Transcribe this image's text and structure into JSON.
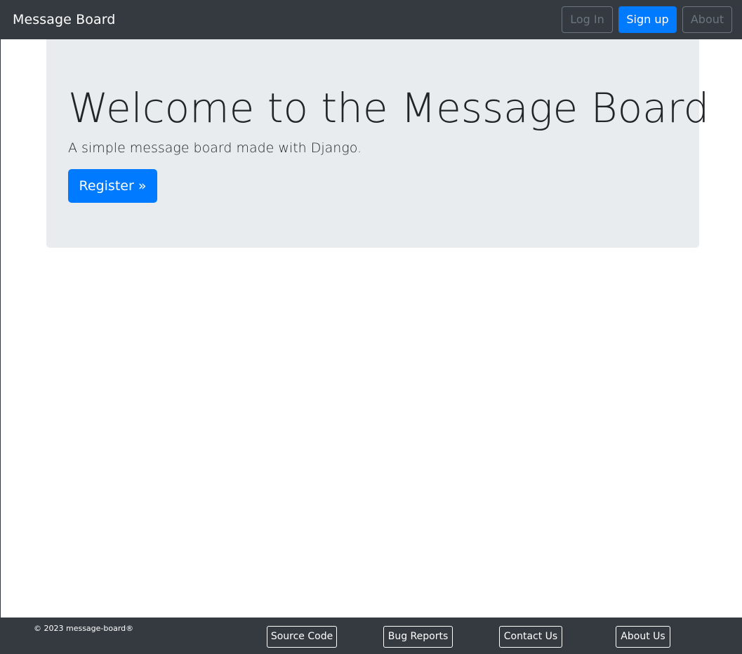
{
  "navbar": {
    "brand": "Message Board",
    "login_label": "Log In",
    "signup_label": "Sign up",
    "about_label": "About"
  },
  "jumbotron": {
    "title": "Welcome to the Message Board",
    "lead": "A simple message board made with Django.",
    "register_label": "Register »"
  },
  "footer": {
    "copyright": "© 2023 message-board®",
    "links": {
      "source_code": "Source Code",
      "bug_reports": "Bug Reports",
      "contact_us": "Contact Us",
      "about_us": "About Us"
    }
  },
  "colors": {
    "navbar_bg": "#343a40",
    "primary": "#007bff",
    "jumbotron_bg": "#e9ecef",
    "muted": "#6c757d"
  }
}
